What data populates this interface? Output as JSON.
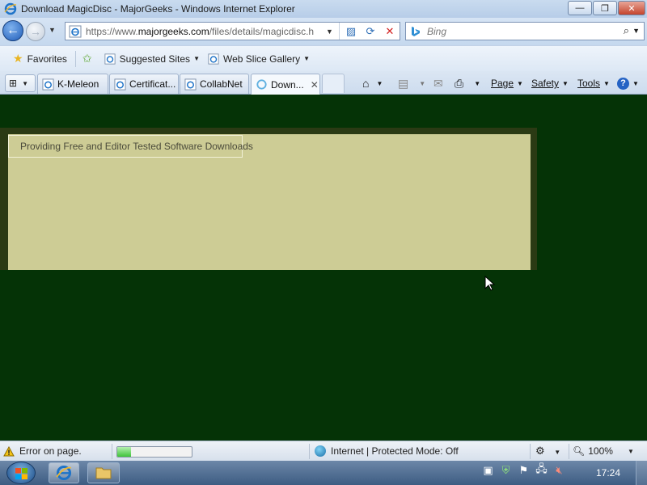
{
  "window": {
    "title": "Download MagicDisc - MajorGeeks - Windows Internet Explorer",
    "buttons": {
      "minimize": "—",
      "maximize": "❐",
      "close": "✕"
    }
  },
  "nav": {
    "back_icon": "←",
    "forward_icon": "→",
    "url_prefix": "https://www.",
    "url_host": "majorgeeks.com",
    "url_path": "/files/details/magicdisc.h",
    "search_placeholder": "Bing",
    "search_go": "⌕"
  },
  "favorites_bar": {
    "favorites_label": "Favorites",
    "items": [
      {
        "label": "Suggested Sites"
      },
      {
        "label": "Web Slice Gallery"
      }
    ]
  },
  "tabs": [
    {
      "label": "K-Meleon"
    },
    {
      "label": "Certificat..."
    },
    {
      "label": "CollabNet"
    },
    {
      "label": "Down...",
      "active": true
    }
  ],
  "commands": {
    "page": "Page",
    "safety": "Safety",
    "tools": "Tools",
    "help": "?"
  },
  "page": {
    "ad_text": "Providing Free and Editor Tested Software Downloads",
    "background_color": "#053306",
    "box_color": "#cdcc95"
  },
  "status": {
    "error_text": "Error on page.",
    "progress": 0.18,
    "zone_text": "Internet | Protected Mode: Off",
    "zoom_text": "100%"
  },
  "taskbar": {
    "clock": "17:24"
  }
}
